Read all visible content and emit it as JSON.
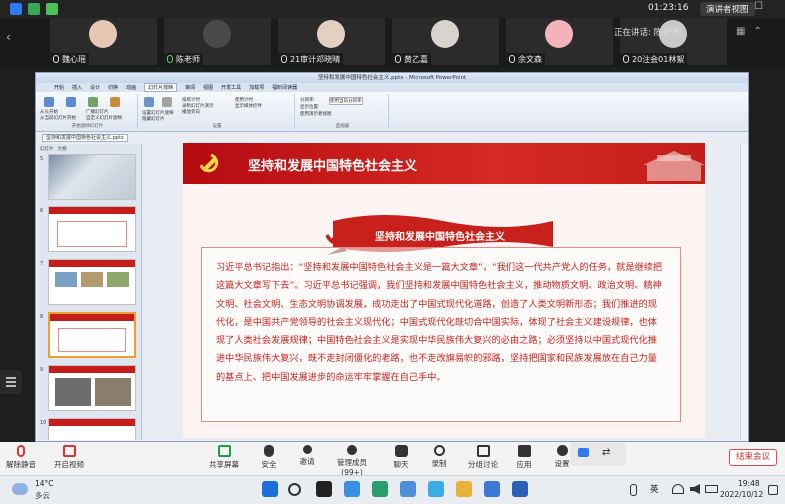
{
  "meeting": {
    "timer": "01:23:16",
    "speaker_view_label": "演讲者视图",
    "talking_label": "正在讲话: 陈老师;",
    "participants": [
      {
        "name": "魏心瑶",
        "color": "#e8c6b4"
      },
      {
        "name": "陈老师",
        "color": "#4a4a4a"
      },
      {
        "name": "21审计邓晓晴",
        "color": "#e3d0c2"
      },
      {
        "name": "黄乙嘉",
        "color": "#d8d3cc"
      },
      {
        "name": "余文森",
        "color": "#f2b4b8"
      },
      {
        "name": "20注会01林絮",
        "color": "#c9c9c9"
      }
    ]
  },
  "ppt": {
    "window_title": "坚持和发展中国特色社会主义.pptx - Microsoft PowerPoint",
    "ribbon_tabs": [
      "开始",
      "插入",
      "设计",
      "切换",
      "动画",
      "幻灯片放映",
      "审阅",
      "视图",
      "开发工具",
      "加载项",
      "福昕阅读器"
    ],
    "active_tab_index": 5,
    "doc_tab": "坚持和发展中国特色社会主义.pptx",
    "thumb_tabs": [
      "幻灯片",
      "大纲"
    ],
    "ribbon_groups": [
      {
        "label": "开始放映幻灯片",
        "buttons": [
          "从头开始",
          "从当前幻灯片开始",
          "广播幻灯片",
          "自定义幻灯片放映"
        ]
      },
      {
        "label": "设置",
        "buttons": [
          "设置幻灯片放映",
          "隐藏幻灯片",
          "排练计时",
          "录制幻灯片演示",
          "播放旁白",
          "使用计时",
          "显示媒体控件"
        ]
      },
      {
        "label": "监视器",
        "buttons": [
          "分辨率:",
          "使用当前分辨率",
          "显示位置:",
          "使用演示者视图"
        ]
      }
    ],
    "slide_numbers": [
      "5",
      "6",
      "7",
      "8",
      "9",
      "10"
    ]
  },
  "slide": {
    "title": "坚持和发展中国特色社会主义",
    "subtitle": "坚持和发展中国特色社会主义",
    "body": "习近平总书记指出：“坚持和发展中国特色社会主义是一篇大文章”，“我们这一代共产党人的任务，就是继续把这篇大文章写下去”。习近平总书记强调，我们坚持和发展中国特色社会主义，推动物质文明、政治文明、精神文明、社会文明、生态文明协调发展，成功走出了中国式现代化道路，创造了人类文明新形态；我们推进的现代化，是中国共产党领导的社会主义现代化；中国式现代化既切合中国实际，体现了社会主义建设规律，也体现了人类社会发展规律；中国特色社会主义是实现中华民族伟大复兴的必由之路；必须坚持以中国式现代化推进中华民族伟大复兴，既不走封闭僵化的老路，也不走改旗易帜的邪路，坚持把国家和民族发展放在自己力量的基点上、把中国发展进步的命运牢牢掌握在自己手中。",
    "colors": {
      "header": "#c41d1a",
      "text": "#c8251f"
    }
  },
  "toolbar": {
    "mute": "解除静音",
    "video": "开启视频",
    "share": "共享屏幕",
    "security": "安全",
    "invite": "邀请",
    "members": "管理成员(99+)",
    "chat": "聊天",
    "record": "录制",
    "breakout": "分组讨论",
    "apps": "应用",
    "settings": "设置",
    "leave": "结束会议"
  },
  "taskbar": {
    "temp": "14°C",
    "weather": "多云",
    "lang": "英",
    "time": "19:48",
    "date": "2022/10/12"
  }
}
